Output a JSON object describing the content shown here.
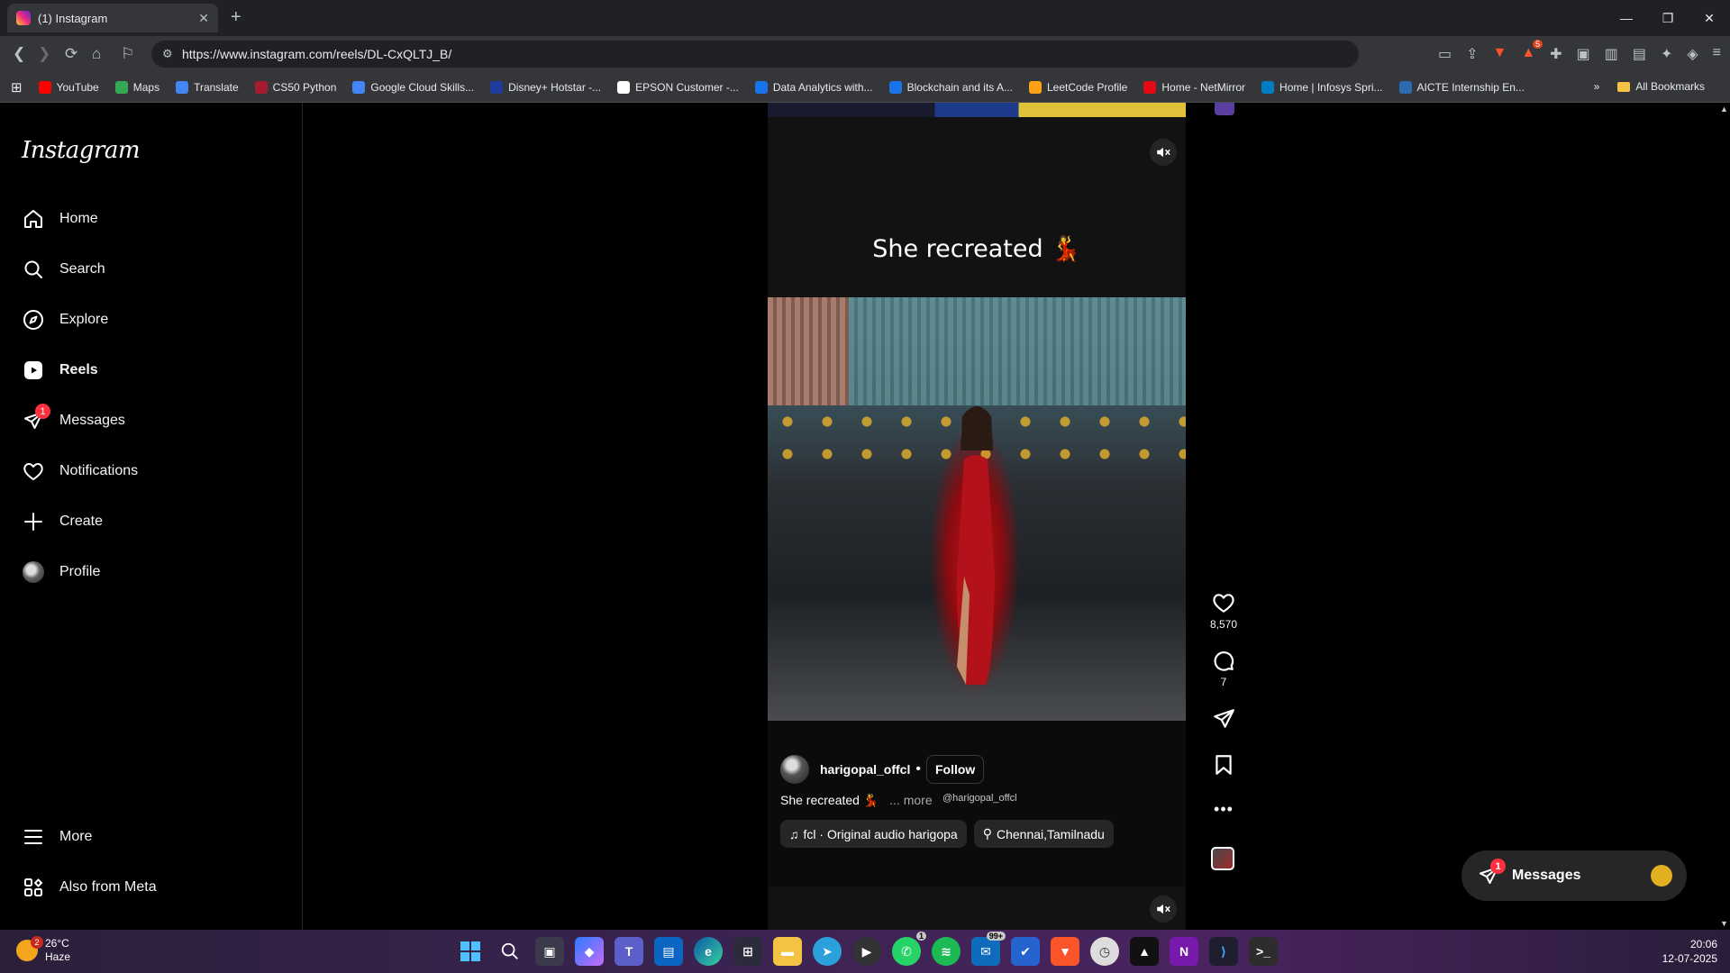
{
  "browser": {
    "tab_title": "(1) Instagram",
    "url": "https://www.instagram.com/reels/DL-CxQLTJ_B/",
    "extension_badge": "5",
    "bookmarks": [
      {
        "label": "YouTube",
        "color": "#ff0000"
      },
      {
        "label": "Maps",
        "color": "#34a853"
      },
      {
        "label": "Translate",
        "color": "#4285f4"
      },
      {
        "label": "CS50 Python",
        "color": "#a51c30"
      },
      {
        "label": "Google Cloud Skills...",
        "color": "#4285f4"
      },
      {
        "label": "Disney+ Hotstar -...",
        "color": "#1f3b9c"
      },
      {
        "label": "EPSON Customer -...",
        "color": "#ffffff"
      },
      {
        "label": "Data Analytics with...",
        "color": "#1a73e8"
      },
      {
        "label": "Blockchain and its A...",
        "color": "#1a73e8"
      },
      {
        "label": "LeetCode Profile",
        "color": "#ffa116"
      },
      {
        "label": "Home - NetMirror",
        "color": "#e50914"
      },
      {
        "label": "Home | Infosys Spri...",
        "color": "#007cc3"
      },
      {
        "label": "AICTE Internship En...",
        "color": "#2b6cb0"
      }
    ],
    "all_bookmarks": "All Bookmarks"
  },
  "sidebar": {
    "logo": "Instagram",
    "items": [
      {
        "label": "Home",
        "icon": "home-icon"
      },
      {
        "label": "Search",
        "icon": "search-icon"
      },
      {
        "label": "Explore",
        "icon": "compass-icon"
      },
      {
        "label": "Reels",
        "icon": "reels-icon"
      },
      {
        "label": "Messages",
        "icon": "messenger-icon",
        "badge": "1"
      },
      {
        "label": "Notifications",
        "icon": "heart-icon"
      },
      {
        "label": "Create",
        "icon": "plus-icon"
      },
      {
        "label": "Profile",
        "icon": "avatar"
      }
    ],
    "more": "More",
    "also_from_meta": "Also from Meta"
  },
  "reel": {
    "overlay_text": "She recreated 💃",
    "author": "harigopal_offcl",
    "follow": "Follow",
    "handle_tag": "@harigopal_offcl",
    "caption": "She recreated 💃",
    "more": "... more",
    "audio": "fcl · Original audio  harigopa",
    "location": "Chennai,Tamilnadu",
    "likes": "8,570",
    "comments": "7"
  },
  "messages_float": {
    "label": "Messages",
    "badge": "1"
  },
  "taskbar": {
    "temperature": "26°C",
    "condition": "Haze",
    "weather_badge": "2",
    "time": "20:06",
    "date": "12-07-2025",
    "whatsapp_badge": "1",
    "mail_badge": "99+"
  }
}
